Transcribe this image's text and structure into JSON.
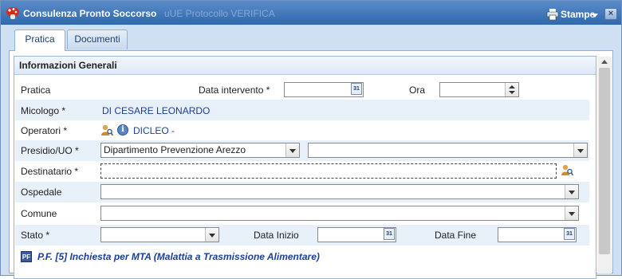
{
  "window": {
    "title": "Consulenza Pronto Soccorso",
    "background_title": "uUE Protocollo    VERIFICA",
    "print_label": "Stampe",
    "close_symbol": "×"
  },
  "tabs": [
    {
      "label": "Pratica",
      "active": true
    },
    {
      "label": "Documenti",
      "active": false
    }
  ],
  "panel": {
    "title": "Informazioni Generali"
  },
  "form": {
    "pratica_label": "Pratica",
    "data_intervento_label": "Data intervento *",
    "data_intervento_value": "",
    "ora_label": "Ora",
    "ora_value": "",
    "micologo_label": "Micologo *",
    "micologo_value": "DI CESARE LEONARDO",
    "operatori_label": "Operatori *",
    "operatori_value": "DICLEO -",
    "presidio_label": "Presidio/UO *",
    "presidio_value": "Dipartimento Prevenzione Arezzo",
    "uo_value": "",
    "destinatario_label": "Destinatario *",
    "destinatario_value": "",
    "ospedale_label": "Ospedale",
    "ospedale_value": "",
    "comune_label": "Comune",
    "comune_value": "",
    "stato_label": "Stato *",
    "stato_value": "",
    "data_inizio_label": "Data Inizio",
    "data_inizio_value": "",
    "data_fine_label": "Data Fine",
    "data_fine_value": ""
  },
  "pf": {
    "badge": "PF",
    "text": "P.F.  [5] Inchiesta per MTA (Malattia a Trasmissione Alimentare)"
  },
  "icons": {
    "calendar_glyph": "31",
    "info_glyph": "i"
  },
  "colors": {
    "titlebar": "#2f68ad",
    "link_value": "#1c3f9a",
    "row_alt": "#e8f0fa"
  }
}
